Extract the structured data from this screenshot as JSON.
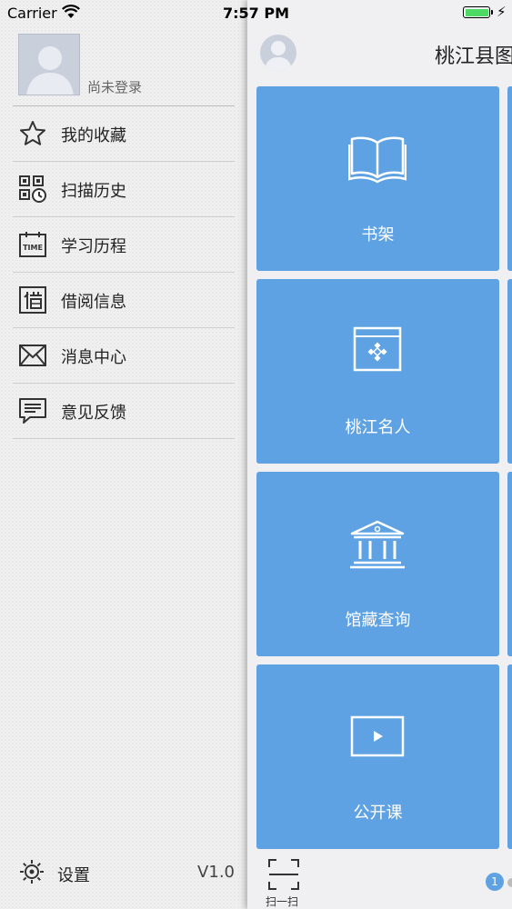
{
  "status_bar": {
    "carrier": "Carrier",
    "time": "7:57 PM"
  },
  "drawer": {
    "login_status": "尚未登录",
    "menu": [
      {
        "label": "我的收藏",
        "icon": "star-icon"
      },
      {
        "label": "扫描历史",
        "icon": "qr-history-icon"
      },
      {
        "label": "学习历程",
        "icon": "time-calendar-icon"
      },
      {
        "label": "借阅信息",
        "icon": "borrow-icon"
      },
      {
        "label": "消息中心",
        "icon": "envelope-icon"
      },
      {
        "label": "意见反馈",
        "icon": "chat-icon"
      }
    ],
    "settings_label": "设置",
    "version": "V1.0"
  },
  "main": {
    "title": "桃江县图",
    "tiles": [
      {
        "label": "书架",
        "icon": "book-icon"
      },
      {
        "label": "桃江名人",
        "icon": "emblem-icon"
      },
      {
        "label": "馆藏查询",
        "icon": "building-icon"
      },
      {
        "label": "公开课",
        "icon": "video-play-icon"
      }
    ],
    "scan_label": "扫一扫",
    "page_number": "1"
  },
  "colors": {
    "tile_blue": "#5ea2e3",
    "battery_green": "#4cd964"
  }
}
